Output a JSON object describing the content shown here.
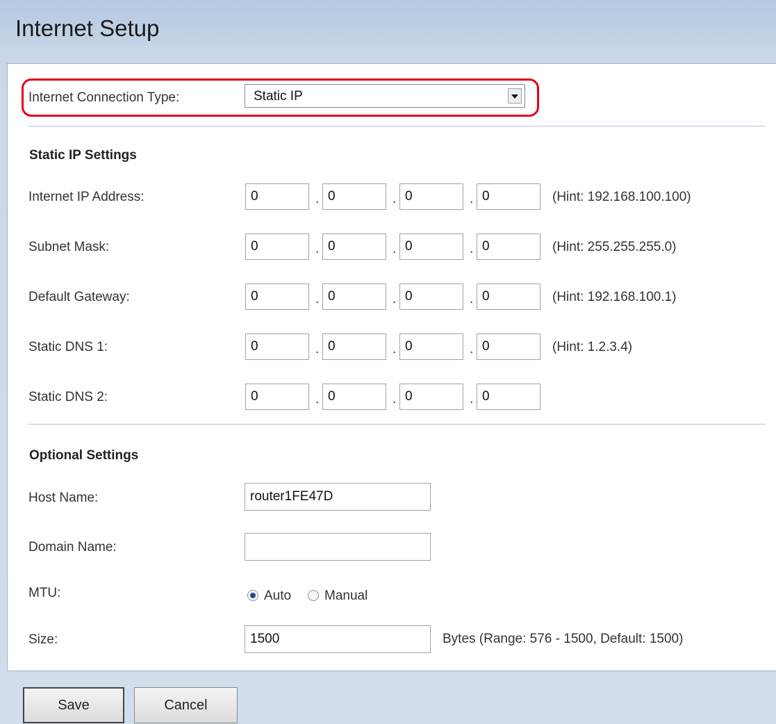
{
  "page": {
    "title": "Internet Setup"
  },
  "connection": {
    "label": "Internet Connection Type:",
    "selected": "Static IP"
  },
  "static_ip": {
    "section_title": "Static IP Settings",
    "rows": [
      {
        "label": "Internet IP Address:",
        "octets": [
          "0",
          "0",
          "0",
          "0"
        ],
        "hint": "(Hint: 192.168.100.100)"
      },
      {
        "label": "Subnet Mask:",
        "octets": [
          "0",
          "0",
          "0",
          "0"
        ],
        "hint": "(Hint: 255.255.255.0)"
      },
      {
        "label": "Default Gateway:",
        "octets": [
          "0",
          "0",
          "0",
          "0"
        ],
        "hint": "(Hint: 192.168.100.1)"
      },
      {
        "label": "Static DNS 1:",
        "octets": [
          "0",
          "0",
          "0",
          "0"
        ],
        "hint": "(Hint: 1.2.3.4)"
      },
      {
        "label": "Static DNS 2:",
        "octets": [
          "0",
          "0",
          "0",
          "0"
        ],
        "hint": ""
      }
    ]
  },
  "optional": {
    "section_title": "Optional Settings",
    "host_name": {
      "label": "Host Name:",
      "value": "router1FE47D"
    },
    "domain_name": {
      "label": "Domain Name:",
      "value": ""
    },
    "mtu": {
      "label": "MTU:",
      "options": [
        "Auto",
        "Manual"
      ],
      "selected": "Auto"
    },
    "size": {
      "label": "Size:",
      "value": "1500",
      "note": "Bytes (Range: 576 - 1500, Default: 1500)"
    }
  },
  "buttons": {
    "save": "Save",
    "cancel": "Cancel"
  },
  "colors": {
    "highlight": "#e3001b",
    "background": "#c9d7e8",
    "radio_selected": "#1f4f95"
  }
}
